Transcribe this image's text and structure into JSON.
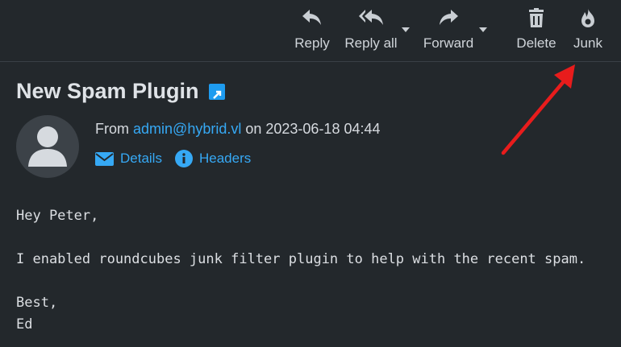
{
  "toolbar": {
    "reply_label": "Reply",
    "reply_all_label": "Reply all",
    "forward_label": "Forward",
    "delete_label": "Delete",
    "junk_label": "Junk"
  },
  "message": {
    "subject": "New Spam Plugin",
    "from_prefix": "From",
    "from_address": "admin@hybrid.vl",
    "date_text": "on 2023-06-18 04:44",
    "details_label": "Details",
    "headers_label": "Headers",
    "body": {
      "line1": "Hey Peter,",
      "line2": "I enabled roundcubes junk filter plugin to help with the recent spam.",
      "line3": "Best,",
      "line4": "Ed"
    }
  },
  "colors": {
    "background": "#23282c",
    "link": "#36a9f5",
    "annotation_arrow": "#e81c1c"
  }
}
